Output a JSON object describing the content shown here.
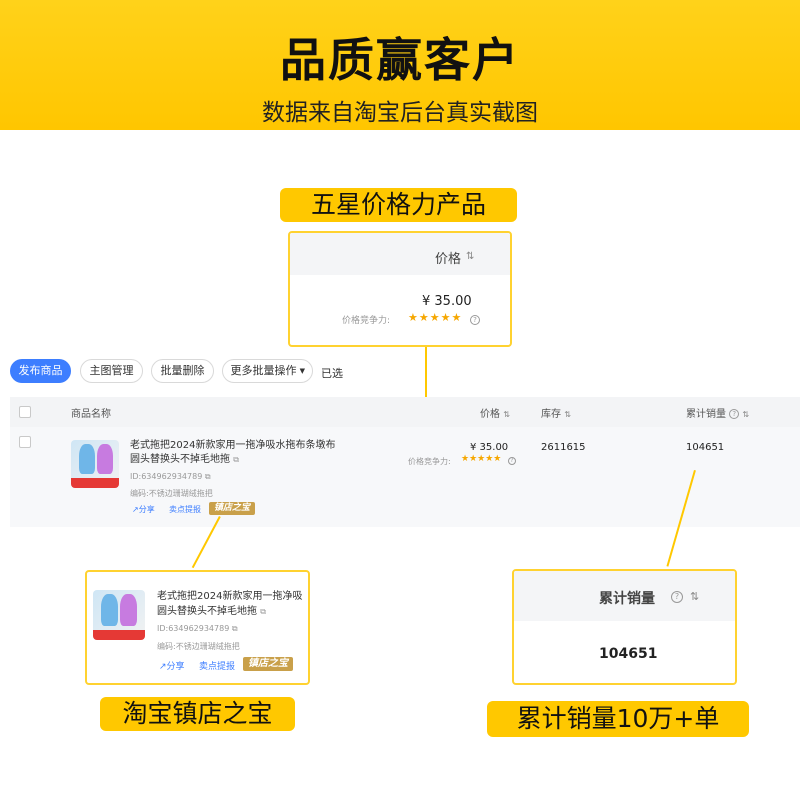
{
  "banner": {
    "title": "品质赢客户",
    "subtitle": "数据来自淘宝后台真实截图"
  },
  "labels": {
    "price_power": "五星价格力产品",
    "store_treasure": "淘宝镇店之宝",
    "cumulative_sales": "累计销量10万+单"
  },
  "price_callout": {
    "header": "价格",
    "sort_icon": "⇅",
    "price": "¥ 35.00",
    "competitiveness_label": "价格竞争力:",
    "stars": "★★★★★"
  },
  "sales_callout": {
    "header": "累计销量",
    "sort_icon": "⇅",
    "value": "104651"
  },
  "toolbar": {
    "publish": "发布商品",
    "main_image": "主图管理",
    "batch_delete": "批量删除",
    "more_batch": "更多批量操作",
    "selected": "已选"
  },
  "table": {
    "columns": {
      "name": "商品名称",
      "price": "价格",
      "stock": "库存",
      "sales": "累计销量"
    },
    "row": {
      "title_line1": "老式拖把2024新款家用一拖净吸水拖布条墩布",
      "title_line2": "圆头替换头不掉毛地拖",
      "id": "ID:634962934789",
      "code": "编码:不锈边珊瑚绒拖把",
      "share": "分享",
      "seller_tip": "卖点提报",
      "badge": "镇店之宝",
      "price": "¥ 35.00",
      "competitiveness_label": "价格竞争力:",
      "stars": "★★★★★",
      "stock": "2611615",
      "sales": "104651"
    }
  },
  "product_callout": {
    "title_line1": "老式拖把2024新款家用一拖净吸",
    "title_line2": "圆头替换头不掉毛地拖",
    "id": "ID:634962934789",
    "code": "编码:不锈边珊瑚绒拖把",
    "share": "分享",
    "seller_tip": "卖点提报",
    "badge": "镇店之宝"
  },
  "colors": {
    "accent_yellow": "#ffc800",
    "primary_blue": "#3d7eff",
    "star_orange": "#f6a700",
    "badge_gold": "#c9a04a"
  }
}
